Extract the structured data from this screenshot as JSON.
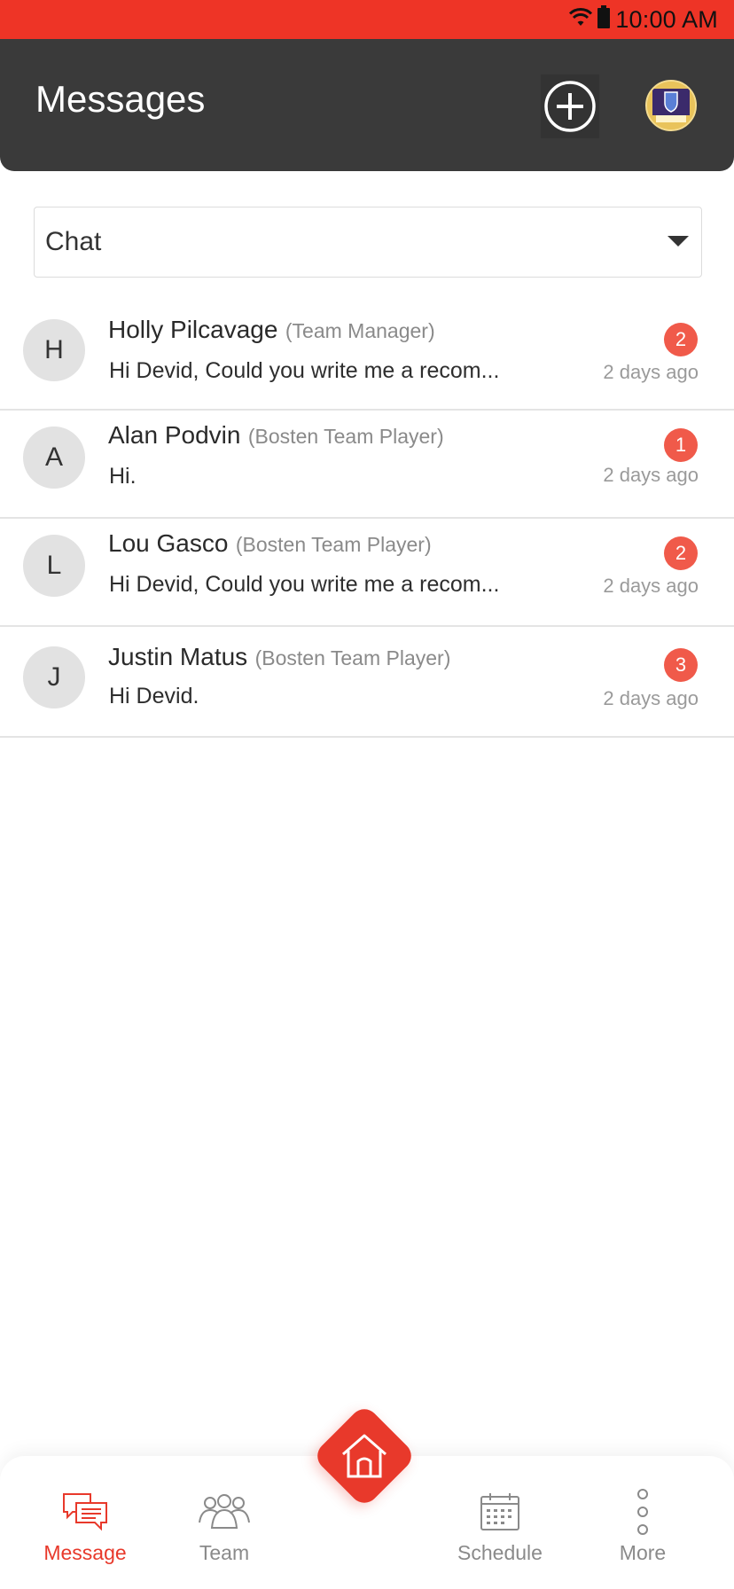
{
  "status_bar": {
    "time": "10:00 AM"
  },
  "header": {
    "title": "Messages",
    "add_icon": "plus-circle-icon",
    "avatar_icon": "team-crest-avatar"
  },
  "filter": {
    "selected": "Chat"
  },
  "messages": [
    {
      "initial": "H",
      "name": "Holly Pilcavage",
      "role": "(Team Manager)",
      "preview": "Hi Devid, Could you write me a recom...",
      "unread": "2",
      "time": "2 days ago"
    },
    {
      "initial": "A",
      "name": "Alan Podvin",
      "role": "(Bosten Team Player)",
      "preview": "Hi.",
      "unread": "1",
      "time": "2 days ago"
    },
    {
      "initial": "L",
      "name": "Lou Gasco",
      "role": "(Bosten Team Player)",
      "preview": "Hi Devid, Could you write me a recom...",
      "unread": "2",
      "time": "2 days ago"
    },
    {
      "initial": "J",
      "name": "Justin Matus",
      "role": "(Bosten Team Player)",
      "preview": "Hi Devid.",
      "unread": "3",
      "time": "2 days ago"
    }
  ],
  "bottom_nav": {
    "items": [
      {
        "label": "Message",
        "icon": "chat-bubbles-icon",
        "active": true
      },
      {
        "label": "Team",
        "icon": "team-group-icon",
        "active": false
      },
      {
        "label": "Schedule",
        "icon": "calendar-icon",
        "active": false
      },
      {
        "label": "More",
        "icon": "more-vertical-icon",
        "active": false
      }
    ],
    "home_icon": "home-icon"
  },
  "colors": {
    "accent": "#e8392b",
    "status_bar": "#ee3426",
    "header": "#3a3a3a",
    "badge": "#f05a4a"
  }
}
